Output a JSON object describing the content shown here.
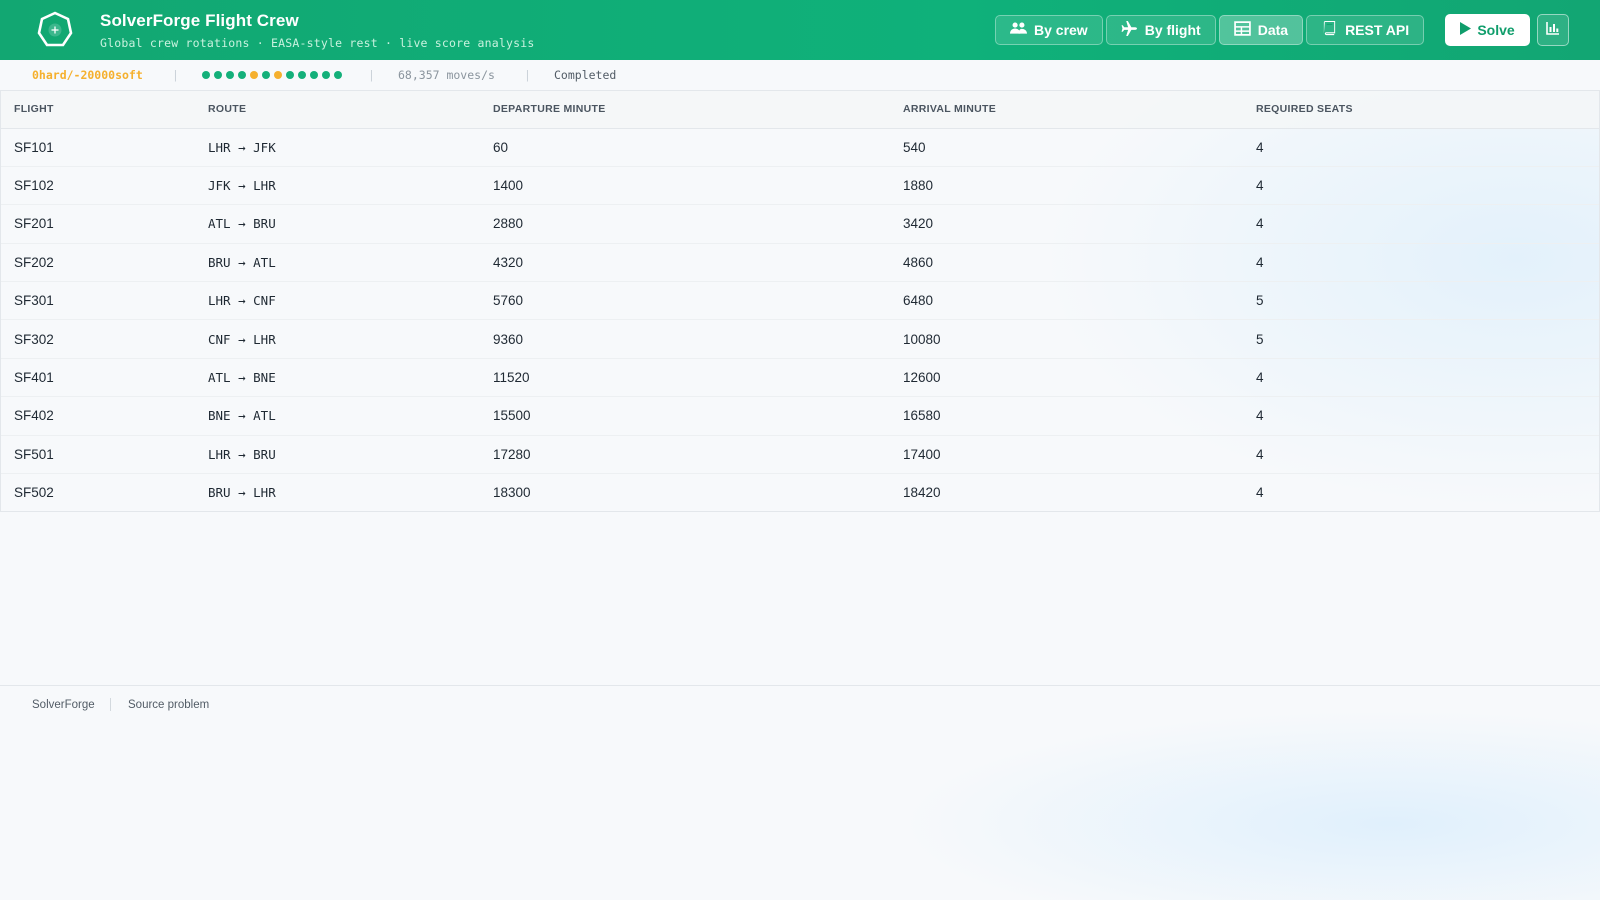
{
  "header": {
    "title": "SolverForge Flight Crew",
    "subtitle": "Global crew rotations · EASA-style rest · live score analysis",
    "nav": [
      {
        "label": "By crew",
        "icon": "users-icon",
        "active": false
      },
      {
        "label": "By flight",
        "icon": "plane-icon",
        "active": false
      },
      {
        "label": "Data",
        "icon": "table-icon",
        "active": true
      },
      {
        "label": "REST API",
        "icon": "book-icon",
        "active": false
      }
    ],
    "solve_label": "Solve",
    "chart_icon": "chart-icon"
  },
  "statusbar": {
    "score": "0hard/-20000soft",
    "dots": [
      "green",
      "green",
      "green",
      "green",
      "amber",
      "green",
      "amber",
      "green",
      "green",
      "green",
      "green",
      "green"
    ],
    "moves": "68,357 moves/s",
    "status": "Completed"
  },
  "colors": {
    "green": "#14b07a",
    "amber": "#f5b02e",
    "score": "#f5b02e"
  },
  "table": {
    "columns": [
      "FLIGHT",
      "ROUTE",
      "DEPARTURE MINUTE",
      "ARRIVAL MINUTE",
      "REQUIRED SEATS"
    ],
    "rows": [
      [
        "SF101",
        "LHR → JFK",
        "60",
        "540",
        "4"
      ],
      [
        "SF102",
        "JFK → LHR",
        "1400",
        "1880",
        "4"
      ],
      [
        "SF201",
        "ATL → BRU",
        "2880",
        "3420",
        "4"
      ],
      [
        "SF202",
        "BRU → ATL",
        "4320",
        "4860",
        "4"
      ],
      [
        "SF301",
        "LHR → CNF",
        "5760",
        "6480",
        "5"
      ],
      [
        "SF302",
        "CNF → LHR",
        "9360",
        "10080",
        "5"
      ],
      [
        "SF401",
        "ATL → BNE",
        "11520",
        "12600",
        "4"
      ],
      [
        "SF402",
        "BNE → ATL",
        "15500",
        "16580",
        "4"
      ],
      [
        "SF501",
        "LHR → BRU",
        "17280",
        "17400",
        "4"
      ],
      [
        "SF502",
        "BRU → LHR",
        "18300",
        "18420",
        "4"
      ]
    ]
  },
  "footer": {
    "link1": "SolverForge",
    "link2": "Source problem"
  }
}
